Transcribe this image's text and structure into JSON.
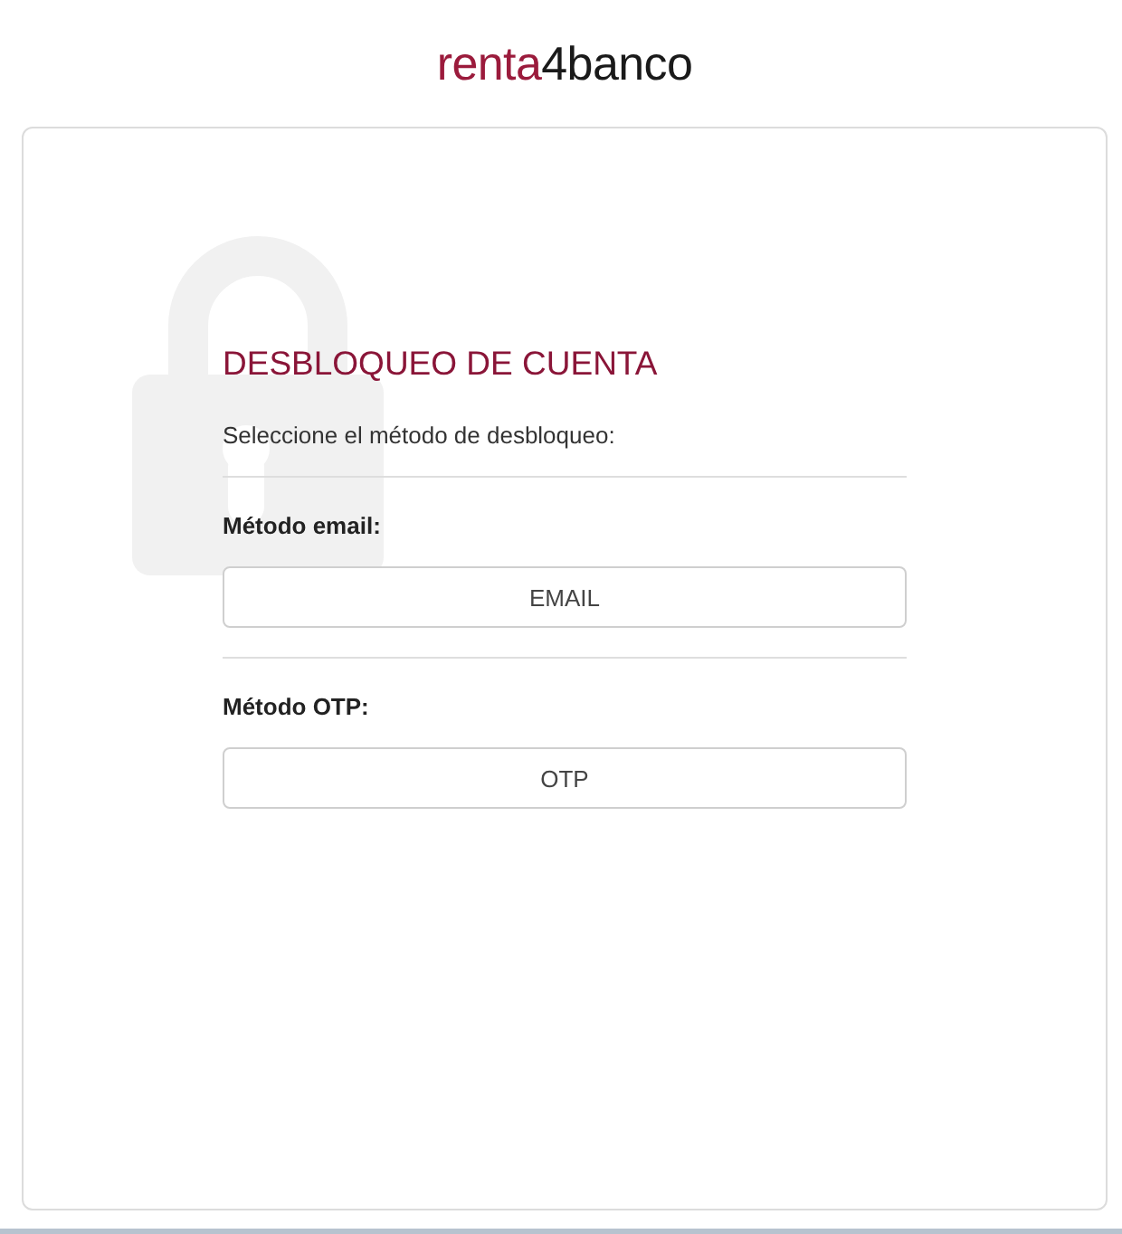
{
  "logo": {
    "accent": "renta",
    "rest": "4banco"
  },
  "panel": {
    "title": "DESBLOQUEO DE CUENTA",
    "subtitle": "Seleccione el método de desbloqueo:",
    "methods": [
      {
        "label": "Método email:",
        "button": "EMAIL"
      },
      {
        "label": "Método OTP:",
        "button": "OTP"
      }
    ]
  }
}
